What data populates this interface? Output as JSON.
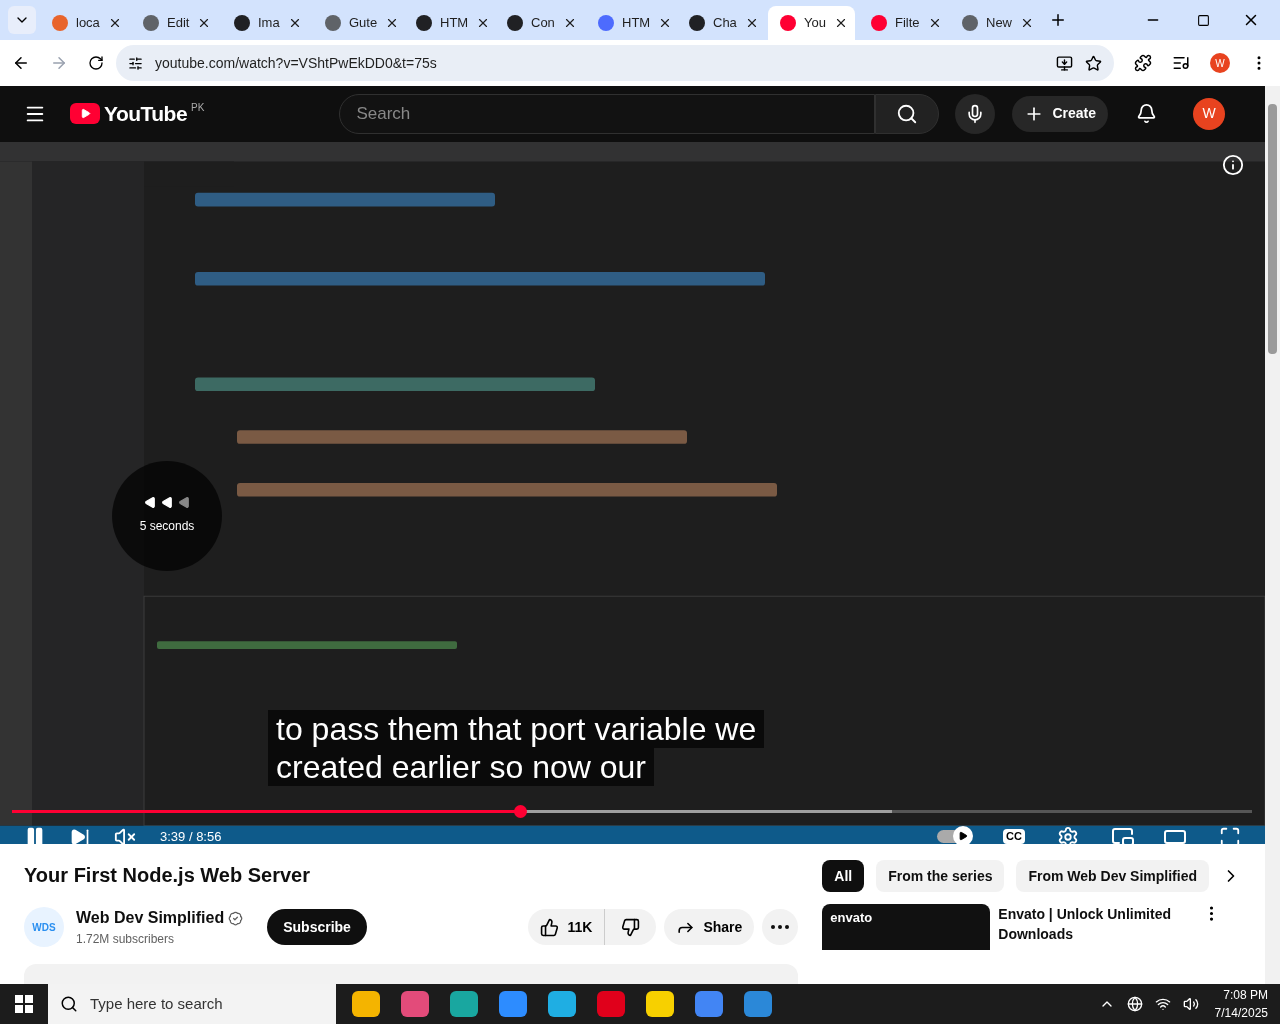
{
  "browser": {
    "tabs": [
      {
        "label": "loca",
        "selected": false,
        "color": "#e8642c"
      },
      {
        "label": "Edit",
        "selected": false,
        "color": "#5f6368"
      },
      {
        "label": "Ima",
        "selected": false,
        "color": "#202124"
      },
      {
        "label": "Gute",
        "selected": false,
        "color": "#5f6368"
      },
      {
        "label": "HTM",
        "selected": false,
        "color": "#202124"
      },
      {
        "label": "Con",
        "selected": false,
        "color": "#202124"
      },
      {
        "label": "HTM",
        "selected": false,
        "color": "#4d6bfe"
      },
      {
        "label": "Cha",
        "selected": false,
        "color": "#202124"
      },
      {
        "label": "You",
        "selected": true,
        "color": "#ff0033"
      },
      {
        "label": "Filte",
        "selected": false,
        "color": "#ff0033"
      },
      {
        "label": "New",
        "selected": false,
        "color": "#5f6368"
      }
    ],
    "url": "youtube.com/watch?v=VShtPwEkDD0&t=75s",
    "profile": "W"
  },
  "youtube": {
    "logo": "YouTube",
    "region": "PK",
    "search": {
      "placeholder": "Search"
    },
    "create": "Create",
    "avatar": "W"
  },
  "player": {
    "seek_label": "5 seconds",
    "subtitles": [
      "to pass them that port variable we",
      "created earlier so now our"
    ],
    "progress": {
      "level": 0.41
    },
    "buffered": {
      "level": 0.71
    },
    "time": "3:39 / 8:56",
    "paused": false,
    "muted": true,
    "autoplay": true,
    "captions": "CC"
  },
  "video": {
    "title": "Your First Node.js Web Server",
    "channel": "Web Dev Simplified",
    "channel_logo": "WDS",
    "verified": true,
    "subscribers": "1.72M subscribers",
    "subscribe": "Subscribe",
    "likes": "11K",
    "share": "Share"
  },
  "sidebar": {
    "chips": [
      {
        "label": "All",
        "selected": true
      },
      {
        "label": "From the series",
        "selected": false
      },
      {
        "label": "From Web Dev Simplified",
        "selected": false
      }
    ],
    "ad": {
      "brand": "envato",
      "title": "Envato | Unlock Unlimited Downloads"
    }
  },
  "taskbar": {
    "search": {
      "placeholder": "Type here to search"
    },
    "time": "7:08 PM",
    "date": "7/14/2025"
  }
}
